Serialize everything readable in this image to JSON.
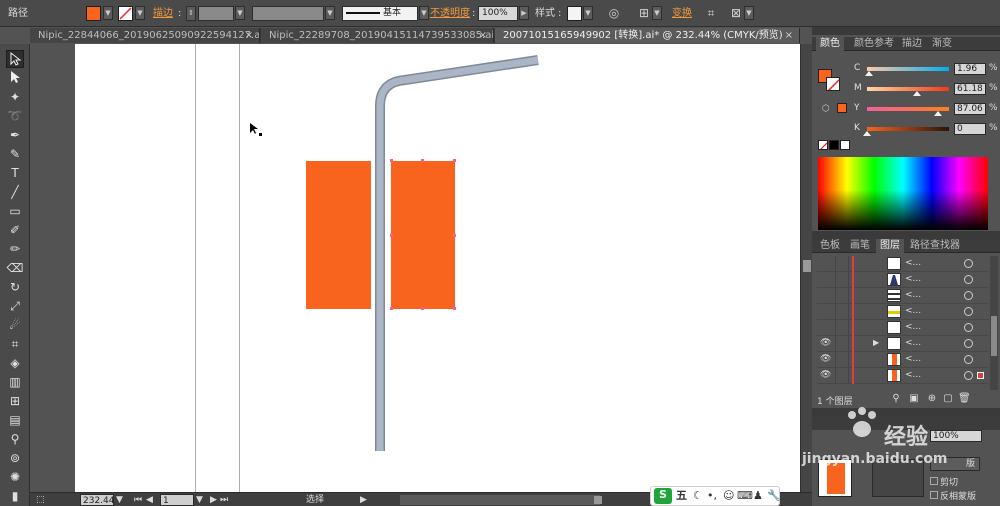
{
  "control_bar": {
    "object_type": "路径",
    "stroke_label": "描边",
    "style_label": "基本",
    "opacity_label": "不透明度",
    "opacity_value": "100%",
    "graphic_style_label": "样式",
    "transform_label": "变换",
    "fill_color": "#f8631d"
  },
  "tabs": [
    {
      "label": "Nipic_22844066_20190625090922594127.ai*",
      "close": "×"
    },
    {
      "label": "Nipic_22289708_20190415114739533085.ai*",
      "close": "×"
    },
    {
      "label": "20071015165949902 [转换].ai* @ 232.44% (CMYK/预览)",
      "close": "×"
    }
  ],
  "status_bar": {
    "zoom": "232.44",
    "artboard": "1",
    "tool": "选择"
  },
  "ime": {
    "mode": "五"
  },
  "color_panel": {
    "tabs": [
      "颜色",
      "颜色参考",
      "描边",
      "渐变"
    ],
    "channels": [
      {
        "label": "C",
        "value": "1.96",
        "fraction": 0.0196
      },
      {
        "label": "M",
        "value": "61.18",
        "fraction": 0.6118
      },
      {
        "label": "Y",
        "value": "87.06",
        "fraction": 0.8706
      },
      {
        "label": "K",
        "value": "0",
        "fraction": 0
      }
    ],
    "percent": "%"
  },
  "layers_panel": {
    "tabs": [
      "色板",
      "画笔",
      "图层",
      "路径查找器"
    ],
    "count_label": "1 个图层",
    "row_name": "<..."
  },
  "transparency_panel": {
    "opacity_value": "100%",
    "clip_label": "剪切",
    "invert_label": "反相蒙版",
    "make_mask_label": "版"
  },
  "watermark": {
    "text": "经验",
    "url": "jingyan.baidu.com"
  },
  "colors": {
    "orange": "#f8631d",
    "pole": "#a9b6c6",
    "ui_dark": "#4a4a4a",
    "accent_text": "#f29a3b"
  }
}
